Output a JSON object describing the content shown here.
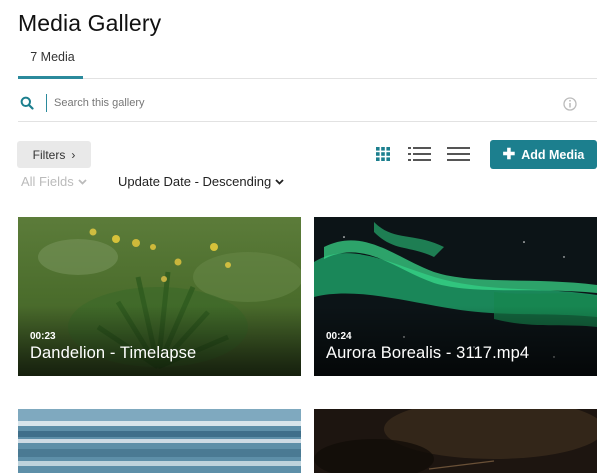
{
  "page": {
    "title": "Media Gallery"
  },
  "tabs": [
    {
      "label": "7 Media"
    }
  ],
  "search": {
    "placeholder": "Search this gallery",
    "icon": "search-icon",
    "info_icon": "info-icon"
  },
  "toolbar": {
    "filters_label": "Filters",
    "views": [
      "grid-view-icon",
      "detailed-list-view-icon",
      "compact-list-view-icon"
    ],
    "add_label": "Add Media",
    "accent": "#1c7f8e"
  },
  "sort": {
    "fields_label": "All Fields",
    "order_label": "Update Date - Descending"
  },
  "media": [
    {
      "duration": "00:23",
      "title": "Dandelion - Timelapse"
    },
    {
      "duration": "00:24",
      "title": "Aurora Borealis - 3117.mp4"
    },
    {
      "duration": "",
      "title": ""
    },
    {
      "duration": "",
      "title": ""
    }
  ]
}
